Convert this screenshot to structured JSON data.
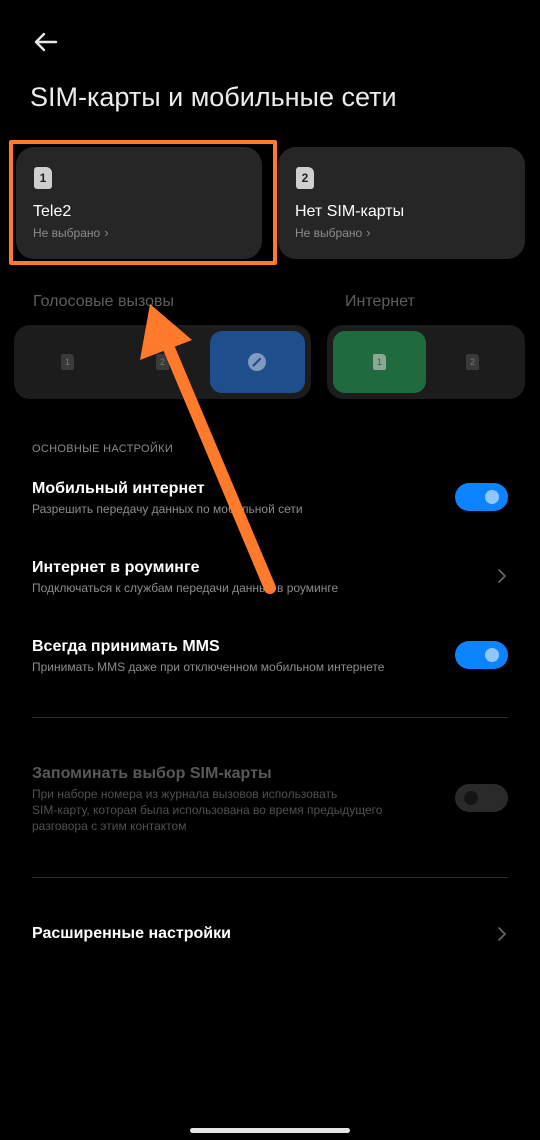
{
  "header": {
    "title": "SIM-карты и мобильные сети",
    "back_icon": "arrow-left-icon"
  },
  "sim_cards": [
    {
      "number": "1",
      "name": "Tele2",
      "status": "Не выбрано"
    },
    {
      "number": "2",
      "name": "Нет SIM-карты",
      "status": "Не выбрано"
    }
  ],
  "selectors": {
    "voice_label": "Голосовые вызовы",
    "internet_label": "Интернет",
    "voice_options": [
      "1",
      "2"
    ],
    "internet_options": [
      "1",
      "2"
    ]
  },
  "settings": {
    "group_header": "ОСНОВНЫЕ НАСТРОЙКИ",
    "mobile_internet": {
      "title": "Мобильный интернет",
      "subtitle": "Разрешить передачу данных по мобильной сети",
      "enabled": true
    },
    "roaming": {
      "title": "Интернет в роуминге",
      "subtitle": "Подключаться к службам передачи данных в роуминге"
    },
    "mms": {
      "title": "Всегда принимать MMS",
      "subtitle": "Принимать MMS даже при отключенном мобильном интернете",
      "enabled": true
    },
    "remember_sim": {
      "title": "Запоминать выбор SIM-карты",
      "subtitle_lines": [
        "При наборе номера из журнала вызовов использовать",
        "SIM-карту, которая была использована во время предыдущего",
        "разговора с этим контактом"
      ],
      "enabled": false
    },
    "advanced": {
      "title": "Расширенные настройки"
    }
  },
  "colors": {
    "accent": "#0d84ff",
    "voice_selected": "#1e4f8c",
    "internet_selected": "#1f6b3f",
    "annotation": "#ff7a2b"
  }
}
